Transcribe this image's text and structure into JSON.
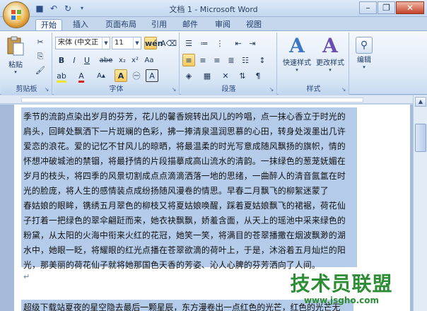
{
  "window": {
    "title": "文档 1 - Microsoft Word"
  },
  "tabs": [
    "开始",
    "插入",
    "页面布局",
    "引用",
    "邮件",
    "审阅",
    "视图"
  ],
  "ribbon": {
    "clipboard": {
      "paste_label": "粘贴",
      "group_label": "剪贴板"
    },
    "font": {
      "font_name": "宋体 (中文正",
      "font_size": "11",
      "group_label": "字体"
    },
    "paragraph": {
      "group_label": "段落"
    },
    "styles": {
      "quick_styles_label": "快速样式",
      "change_styles_label": "更改样式",
      "group_label": "样式"
    },
    "editing": {
      "label": "编辑"
    }
  },
  "document": {
    "lines": [
      "季节的流韵点染出岁月的芬芳，花儿的馨香婉转出风儿的吟唱，点一抹心香立于时光的",
      "肩头，回眸处飘洒下一片斑斓的色彩，拂一捧清泉温润思慕的心田，转身处泼墨出几许",
      "爱恋的浪花。爱的记忆不甘风儿的晾晒，将最温柔的时光写意成随风飘扬的旗帜，情的",
      "怀想冲破城池的禁锢，将最抒情的片段描摹成高山流水的清韵。一抹绿色的葱茏妩媚在",
      "岁月的枝头，将四季的风景切割成点点滴滴洒落一地的思绪，一曲醉人的清音氤氲在时",
      "光的脸庞，将人生的感情装点成纷扬随风漫卷的情思。早春二月飘飞的柳絮迷蒙了",
      "春姑娘的眼眸，镌绣五月翠色的柳枝又将夏姑娘唤醒，踩着夏姑娘飘飞的裙裾，荷花仙",
      "子打着一把绿色的翠伞翩跹而来，她衣袂飘飘，娇羞含面，从天上的瑶池中采来绿色的",
      "粉黛，从太阳的火海中衔来火红的花冠，她笑一笑，将满目的苍翠播撒在烟波飘渺的湖",
      "水中，她眼一眨，将耀眼的红光点播在苍翠欲滴的荷叶上，于是，沐浴着五月灿烂的阳",
      "光，那美丽的荷花仙子就将她那国色天香的芳姿、沁人心脾的芬芳洒向了人间。"
    ],
    "paragraph_mark": "↵",
    "last_line": "超级下载站夏夜的星空隐去最后一颗星辰，东方漫卷出一点红色的光芒，红色的光芒无"
  },
  "watermark": {
    "text": "技术员联盟",
    "url": "www.jsgho.com"
  }
}
